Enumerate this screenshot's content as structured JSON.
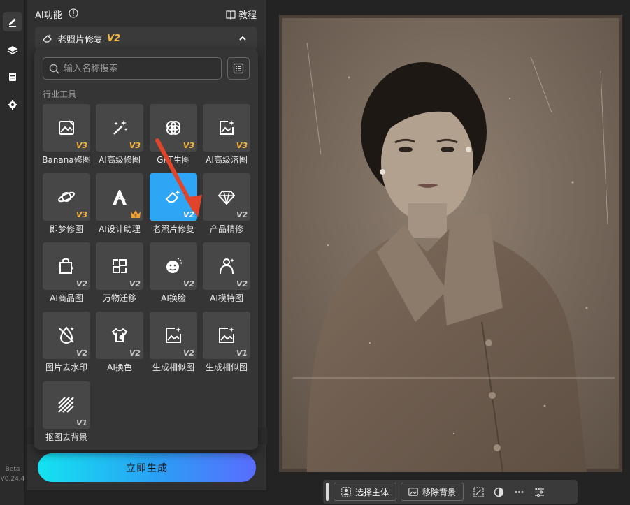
{
  "sidebar": {
    "icons": [
      "pencil-icon",
      "layers-icon",
      "clipboard-icon",
      "gear-icon"
    ],
    "beta": "Beta",
    "version": "V0.24.4"
  },
  "panel": {
    "title": "AI功能",
    "tutorial": "教程",
    "section": {
      "title": "老照片修复",
      "version": "V2"
    },
    "generate_button": "立即生成"
  },
  "popup": {
    "search_placeholder": "输入名称搜索",
    "category": "行业工具",
    "tools": [
      {
        "label": "Banana修图",
        "badge": "V3",
        "icon": "image-edit-icon"
      },
      {
        "label": "AI高级修图",
        "badge": "V3",
        "icon": "magic-wand-icon"
      },
      {
        "label": "GPT生图",
        "badge": "V3",
        "icon": "openai-icon"
      },
      {
        "label": "AI高级溶图",
        "badge": "V3",
        "icon": "image-sparkle-icon"
      },
      {
        "label": "即梦修图",
        "badge": "V3",
        "icon": "planet-icon"
      },
      {
        "label": "AI设计助理",
        "badge": "crown",
        "icon": "design-a-icon"
      },
      {
        "label": "老照片修复",
        "badge": "V2",
        "icon": "eraser-icon",
        "selected": true
      },
      {
        "label": "产品精修",
        "badge": "V2",
        "icon": "diamond-icon"
      },
      {
        "label": "AI商品图",
        "badge": "V2",
        "icon": "shopping-bag-icon"
      },
      {
        "label": "万物迁移",
        "badge": "V2",
        "icon": "transfer-icon"
      },
      {
        "label": "AI换脸",
        "badge": "V2",
        "icon": "face-swap-icon"
      },
      {
        "label": "AI模特图",
        "badge": "V2",
        "icon": "model-icon"
      },
      {
        "label": "图片去水印",
        "badge": "V2",
        "icon": "watermark-remove-icon"
      },
      {
        "label": "AI换色",
        "badge": "V2",
        "icon": "palette-tshirt-icon"
      },
      {
        "label": "生成相似图",
        "badge": "V2",
        "icon": "similar-image-icon"
      },
      {
        "label": "生成相似图",
        "badge": "V1",
        "icon": "similar-image-icon"
      },
      {
        "label": "抠图去背景",
        "badge": "V1",
        "icon": "cutout-icon"
      }
    ]
  },
  "toolbar": {
    "select_subject": "选择主体",
    "remove_background": "移除背景"
  },
  "colors": {
    "accent": "#2ea6f5",
    "badge": "#f5b73b",
    "arrow": "#e0452b"
  }
}
